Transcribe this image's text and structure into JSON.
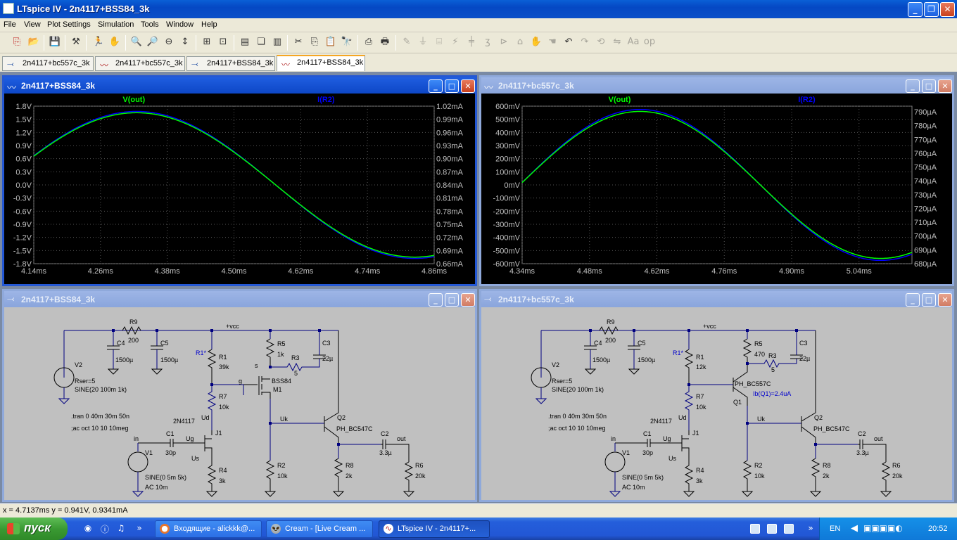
{
  "app": {
    "title": "LTspice IV - 2n4117+BSS84_3k"
  },
  "menu": [
    "File",
    "View",
    "Plot Settings",
    "Simulation",
    "Tools",
    "Window",
    "Help"
  ],
  "toolbar": {
    "icons": [
      "new-schematic-icon",
      "open-icon",
      "save-icon",
      "control-panel-icon",
      "run-icon",
      "halt-icon",
      "zoom-in-icon",
      "zoom-out-icon",
      "zoom-back-icon",
      "autorange-icon",
      "zoom-extent-icon",
      "tile-horizontal-icon",
      "cascade-icon",
      "tile-vertical-icon",
      "cut-icon",
      "copy-icon",
      "paste-icon",
      "find-icon",
      "print-setup-icon",
      "print-icon",
      "wire-icon",
      "ground-icon",
      "label-icon",
      "resistor-icon",
      "capacitor-icon",
      "inductor-icon",
      "diode-icon",
      "component-icon",
      "move-icon",
      "drag-icon",
      "undo-icon",
      "redo-icon",
      "rotate-icon",
      "mirror-icon",
      "text-icon",
      "spice-directive-icon"
    ]
  },
  "tabs": [
    {
      "label": "2n4117+bc557c_3k",
      "icon": "schematic-icon"
    },
    {
      "label": "2n4117+bc557c_3k",
      "icon": "waveform-icon"
    },
    {
      "label": "2n4117+BSS84_3k",
      "icon": "schematic-icon"
    },
    {
      "label": "2n4117+BSS84_3k",
      "icon": "waveform-icon",
      "active": true
    }
  ],
  "windows": {
    "plot_left": {
      "title": "2n4117+BSS84_3k"
    },
    "plot_right": {
      "title": "2n4117+bc557c_3k"
    },
    "sch_left": {
      "title": "2n4117+BSS84_3k"
    },
    "sch_right": {
      "title": "2n4117+bc557c_3k"
    }
  },
  "chart_data": [
    {
      "type": "line",
      "title": "2n4117+BSS84_3k",
      "traces": [
        "V(out)",
        "I(R2)"
      ],
      "x_ticks": [
        "4.14ms",
        "4.26ms",
        "4.38ms",
        "4.50ms",
        "4.62ms",
        "4.74ms",
        "4.86ms"
      ],
      "y_left_ticks": [
        "1.8V",
        "1.5V",
        "1.2V",
        "0.9V",
        "0.6V",
        "0.3V",
        "0.0V",
        "-0.3V",
        "-0.6V",
        "-0.9V",
        "-1.2V",
        "-1.5V",
        "-1.8V"
      ],
      "y_right_ticks": [
        "1.02mA",
        "0.99mA",
        "0.96mA",
        "0.93mA",
        "0.90mA",
        "0.87mA",
        "0.84mA",
        "0.81mA",
        "0.78mA",
        "0.75mA",
        "0.72mA",
        "0.69mA",
        "0.66mA"
      ],
      "xlim": [
        4.14,
        4.86
      ],
      "ylim": [
        -1.8,
        1.8
      ],
      "series": [
        {
          "name": "V(out)",
          "color": "#00ff00",
          "amplitude": 1.65,
          "freq_khz": 1
        },
        {
          "name": "I(R2)",
          "color": "#0000ff",
          "amplitude": 1.68,
          "freq_khz": 1
        }
      ],
      "grid": true
    },
    {
      "type": "line",
      "title": "2n4117+bc557c_3k",
      "traces": [
        "V(out)",
        "I(R2)"
      ],
      "x_ticks": [
        "4.34ms",
        "4.48ms",
        "4.62ms",
        "4.76ms",
        "4.90ms",
        "5.04ms"
      ],
      "y_left_ticks": [
        "600mV",
        "500mV",
        "400mV",
        "300mV",
        "200mV",
        "100mV",
        "0mV",
        "-100mV",
        "-200mV",
        "-300mV",
        "-400mV",
        "-500mV",
        "-600mV"
      ],
      "y_right_ticks": [
        "790µA",
        "780µA",
        "770µA",
        "760µA",
        "750µA",
        "740µA",
        "730µA",
        "720µA",
        "710µA",
        "700µA",
        "690µA",
        "680µA"
      ],
      "xlim": [
        4.34,
        5.15
      ],
      "ylim": [
        -600,
        600
      ],
      "series": [
        {
          "name": "V(out)",
          "color": "#00ff00",
          "amplitude": 560,
          "freq_khz": 1
        },
        {
          "name": "I(R2)",
          "color": "#0000ff",
          "amplitude": 575,
          "freq_khz": 1
        }
      ],
      "grid": true
    }
  ],
  "schematic_left": {
    "net_vcc": "+vcc",
    "R9": "R9",
    "R9v": "200",
    "C4": "C4",
    "C4v": "1500µ",
    "C5": "C5",
    "C5v": "1500µ",
    "V2": "V2",
    "V2a": "Rser=5",
    "V2b": "SINE(20 100m 1k)",
    "R1star": "R1*",
    "R1": "R1",
    "R1v": "39k",
    "R7": "R7",
    "R7v": "10k",
    "R5": "R5",
    "R5v": "1k",
    "R3": "R3",
    "R3v": "5",
    "C3": "C3",
    "C3v": "22µ",
    "s": "s",
    "g": "g",
    "M1": "M1",
    "BSS84": "BSS84",
    "Uk": "Uk",
    "Q2": "Q2",
    "Q2m": "PH_BC547C",
    "tran": ".tran 0 40m 30m 50n",
    "ac": ";ac oct 10 10 10meg",
    "J1t": "2N4117",
    "Ud": "Ud",
    "J1": "J1",
    "C1": "C1",
    "C1v": "30p",
    "in": "in",
    "Ug": "Ug",
    "Us": "Us",
    "V1": "V1",
    "V1a": "SINE(0 5m 5k)",
    "V1b": "AC 10m",
    "R4": "R4",
    "R4v": "3k",
    "R2": "R2",
    "R2v": "10k",
    "R8": "R8",
    "R8v": "2k",
    "C2": "C2",
    "C2v": "3.3µ",
    "out": "out",
    "R6": "R6",
    "R6v": "20k"
  },
  "schematic_right": {
    "net_vcc": "+vcc",
    "R9": "R9",
    "R9v": "200",
    "C4": "C4",
    "C4v": "1500µ",
    "C5": "C5",
    "C5v": "1500µ",
    "V2": "V2",
    "V2a": "Rser=5",
    "V2b": "SINE(20 100m 1k)",
    "R1star": "R1*",
    "R1": "R1",
    "R1v": "12k",
    "R7": "R7",
    "R7v": "10k",
    "R5": "R5",
    "R5v": "470",
    "R3": "R3",
    "R3v": "5",
    "C3": "C3",
    "C3v": "22µ",
    "Q1m": "PH_BC557C",
    "Q1": "Q1",
    "ib": "Ib(Q1)=2.4uA",
    "Uk": "Uk",
    "Q2": "Q2",
    "Q2m": "PH_BC547C",
    "tran": ".tran 0 40m 30m 50n",
    "ac": ";ac oct 10 10 10meg",
    "J1t": "2N4117",
    "Ud": "Ud",
    "J1": "J1",
    "C1": "C1",
    "C1v": "30p",
    "in": "in",
    "Ug": "Ug",
    "Us": "Us",
    "V1": "V1",
    "V1a": "SINE(0 5m 5k)",
    "V1b": "AC 10m",
    "R4": "R4",
    "R4v": "3k",
    "R2": "R2",
    "R2v": "10k",
    "R8": "R8",
    "R8v": "2k",
    "C2": "C2",
    "C2v": "3.3µ",
    "out": "out",
    "R6": "R6",
    "R6v": "20k"
  },
  "status": {
    "text": "x = 4.7137ms    y = 0.941V, 0.9341mA"
  },
  "taskbar": {
    "start": "пуск",
    "tasks": [
      "Входящие - alickkk@...",
      "Cream - [Live Cream ...",
      "LTspice IV - 2n4117+..."
    ],
    "lang": "EN",
    "clock": "20:52"
  },
  "colors": {
    "trace_v": "#00ff00",
    "trace_i": "#0000ff",
    "label_blue": "#0000cc",
    "wire": "#000080"
  }
}
